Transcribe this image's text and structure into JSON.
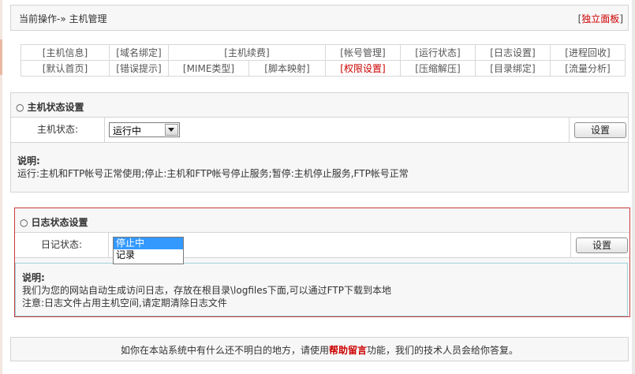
{
  "breadcrumb": {
    "label": "当前操作-» 主机管理",
    "independent_panel": "独立面板"
  },
  "nav": {
    "row1": [
      "主机信息",
      "域名绑定",
      "主机续费",
      "帐号管理",
      "运行状态",
      "日志设置",
      "进程回收"
    ],
    "row2": [
      "默认首页",
      "错误提示",
      "MIME类型",
      "脚本映射",
      "权限设置",
      "压缩解压",
      "目录绑定",
      "流量分析"
    ],
    "active": "权限设置"
  },
  "host_section": {
    "title": "主机状态设置",
    "label": "主机状态:",
    "select_value": "运行中",
    "button": "设置",
    "desc_title": "说明:",
    "desc_text": "运行:主机和FTP帐号正常使用;停止:主机和FTP帐号停止服务;暂停:主机停止服务,FTP帐号正常"
  },
  "log_section": {
    "title": "日志状态设置",
    "label": "日记状态:",
    "options": [
      "停止中",
      "记录"
    ],
    "selected": "停止中",
    "button": "设置",
    "desc_title": "说明:",
    "desc_line1": "我们为您的网站自动生成访问日志，存放在根目录\\logfiles下面,可以通过FTP下载到本地",
    "desc_line2": "注意:日志文件占用主机空间,请定期清除日志文件"
  },
  "footer": {
    "before": "如你在本站系统中有什么还不明白的地方，请使用",
    "link": "帮助留言",
    "after": "功能，我们的技术人员会给你答复。"
  },
  "colors": {
    "accent_red": "#cc0000",
    "selection_blue": "#3399ff",
    "border_red": "#c73c3c"
  }
}
